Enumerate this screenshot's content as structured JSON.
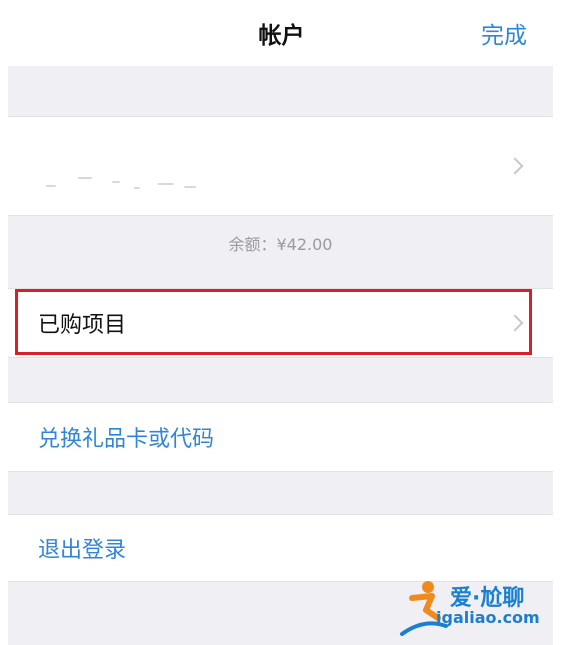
{
  "nav": {
    "title": "帐户",
    "done_label": "完成"
  },
  "account": {
    "balance_text": "余额：¥42.00"
  },
  "menu": {
    "purchased_label": "已购项目",
    "redeem_label": "兑换礼品卡或代码",
    "signout_label": "退出登录"
  },
  "watermark": {
    "title": "爱·尬聊",
    "url": "igaliao.com"
  },
  "colors": {
    "link_blue": "#2f86d8",
    "highlight_red": "#d8202b",
    "group_background": "#efeff4"
  }
}
